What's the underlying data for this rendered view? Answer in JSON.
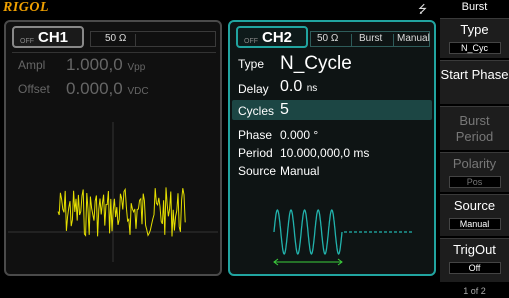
{
  "brand": "RIGOL",
  "usb_icon": "usb-icon",
  "menu_title": "Burst",
  "ch1": {
    "name": "CH1",
    "state": "OFF",
    "impedance": "50 Ω",
    "ampl_label": "Ampl",
    "ampl_value": "1.000,0",
    "ampl_unit": "Vpp",
    "offset_label": "Offset",
    "offset_value": "0.000,0",
    "offset_unit": "VDC"
  },
  "ch2": {
    "name": "CH2",
    "state": "OFF",
    "impedance": "50 Ω",
    "mode": "Burst",
    "trigger": "Manual",
    "params": {
      "type_label": "Type",
      "type_value": "N_Cycle",
      "delay_label": "Delay",
      "delay_value": "0.0",
      "delay_unit": "ns",
      "cycles_label": "Cycles",
      "cycles_value": "5",
      "phase_label": "Phase",
      "phase_value": "0.000 °",
      "period_label": "Period",
      "period_value": "10.000,000,0 ms",
      "source_label": "Source",
      "source_value": "Manual"
    }
  },
  "softkeys": [
    {
      "label": "Type",
      "value": "N_Cyc",
      "enabled": true
    },
    {
      "label": "Start Phase",
      "value": "",
      "enabled": true
    },
    {
      "label": "Burst Period",
      "value": "",
      "enabled": false
    },
    {
      "label": "Polarity",
      "value": "Pos",
      "enabled": false
    },
    {
      "label": "Source",
      "value": "Manual",
      "enabled": true
    },
    {
      "label": "TrigOut",
      "value": "Off",
      "enabled": true
    }
  ],
  "page_indicator": "1 of 2",
  "colors": {
    "accent": "#21a4a0",
    "brand": "#f0a000",
    "ch1_wave": "#e6e000",
    "ch2_wave": "#22b3ad",
    "marker": "#3ccf3c"
  }
}
